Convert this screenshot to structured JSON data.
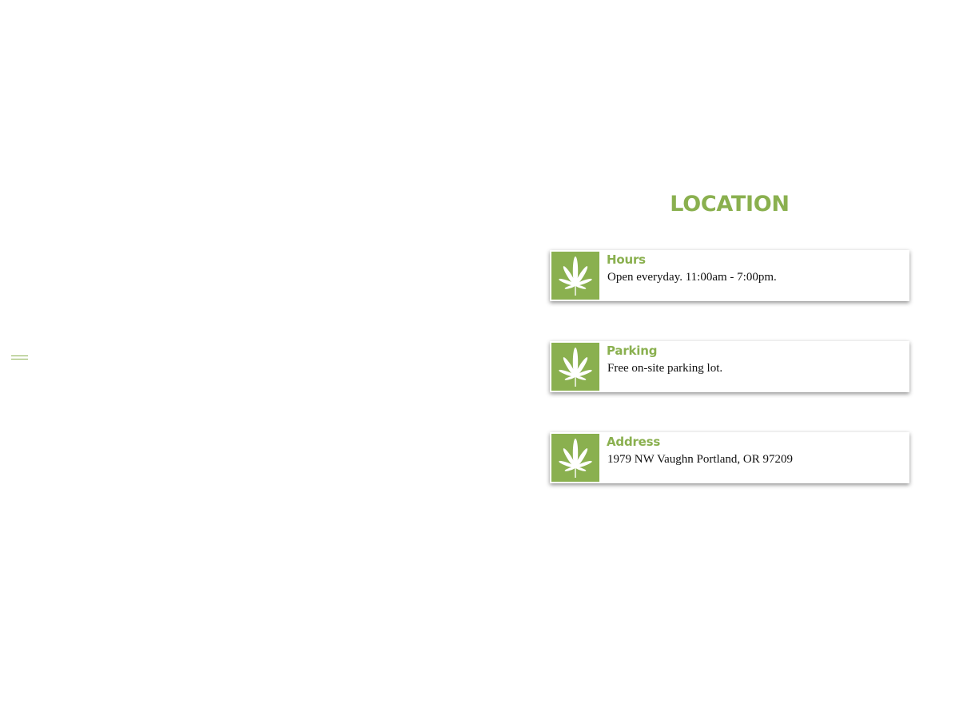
{
  "nav": {
    "menu_icon": "hamburger-menu-icon"
  },
  "location": {
    "title": "LOCATION",
    "accent_color": "#8ab04f",
    "cards": [
      {
        "icon": "cannabis-leaf-icon",
        "title": "Hours",
        "text": "Open everyday. 11:00am - 7:00pm."
      },
      {
        "icon": "cannabis-leaf-icon",
        "title": "Parking",
        "text": "Free on-site parking lot."
      },
      {
        "icon": "cannabis-leaf-icon",
        "title": "Address",
        "text": "1979 NW Vaughn Portland, OR 97209"
      }
    ]
  }
}
